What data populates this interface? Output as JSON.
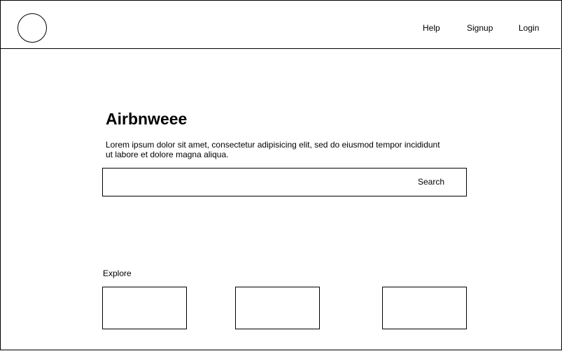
{
  "header": {
    "nav": {
      "help": "Help",
      "signup": "Signup",
      "login": "Login"
    }
  },
  "hero": {
    "title": "Airbnweee",
    "description": "Lorem ipsum dolor sit amet, consectetur adipisicing elit, sed do eiusmod tempor incididunt ut labore et dolore magna aliqua.",
    "search_button": "Search"
  },
  "explore": {
    "label": "Explore",
    "cards": [
      "",
      "",
      ""
    ]
  }
}
